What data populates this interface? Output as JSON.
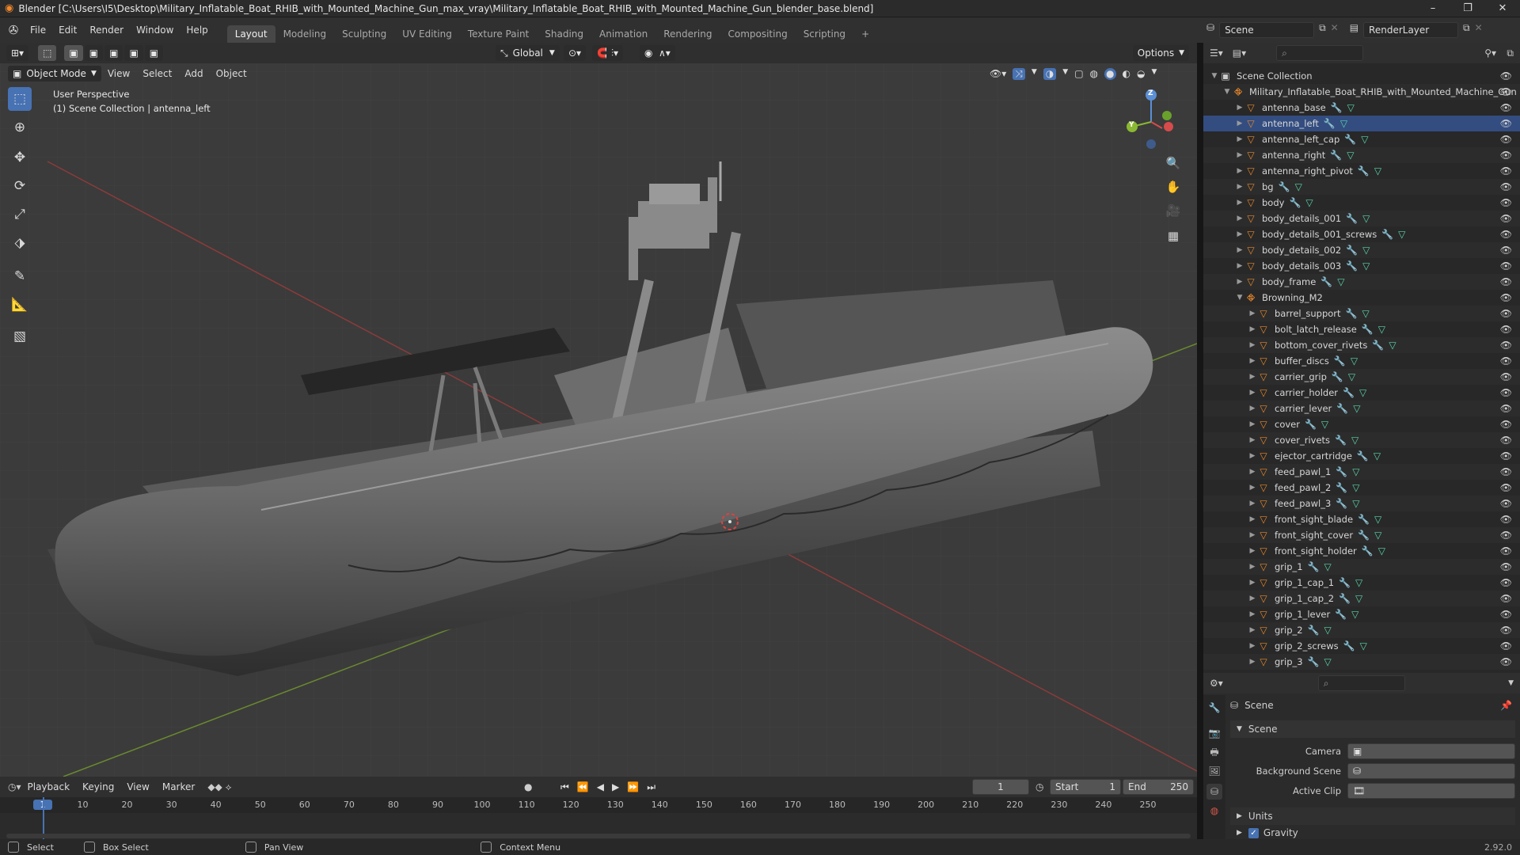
{
  "window": {
    "title": "Blender [C:\\Users\\I5\\Desktop\\Military_Inflatable_Boat_RHIB_with_Mounted_Machine_Gun_max_vray\\Military_Inflatable_Boat_RHIB_with_Mounted_Machine_Gun_blender_base.blend]",
    "controls": [
      "–",
      "❐",
      "✕"
    ]
  },
  "menubar": {
    "menus": [
      "File",
      "Edit",
      "Render",
      "Window",
      "Help"
    ],
    "workspaces": [
      "Layout",
      "Modeling",
      "Sculpting",
      "UV Editing",
      "Texture Paint",
      "Shading",
      "Animation",
      "Rendering",
      "Compositing",
      "Scripting"
    ],
    "active_workspace": "Layout",
    "add_tab": "+",
    "scene_label": "Scene",
    "render_layer_label": "RenderLayer"
  },
  "viewport": {
    "mode": "Object Mode",
    "menus": [
      "View",
      "Select",
      "Add",
      "Object"
    ],
    "transform_orientation": "Global",
    "options_label": "Options",
    "overlay_line1": "User Perspective",
    "overlay_line2": "(1) Scene Collection | antenna_left",
    "gizmo": {
      "x": "X",
      "y": "Y",
      "z": "Z"
    },
    "tools": [
      "select-box-icon",
      "cursor-icon",
      "move-icon",
      "rotate-icon",
      "scale-icon",
      "transform-icon",
      "annotate-icon",
      "measure-icon",
      "add-cube-icon"
    ]
  },
  "outliner": {
    "scene_collection": "Scene Collection",
    "root": "Military_Inflatable_Boat_RHIB_with_Mounted_Machine_Gun",
    "items": [
      {
        "name": "antenna_base",
        "level": 1
      },
      {
        "name": "antenna_left",
        "level": 1,
        "selected": true
      },
      {
        "name": "antenna_left_cap",
        "level": 1
      },
      {
        "name": "antenna_right",
        "level": 1
      },
      {
        "name": "antenna_right_pivot",
        "level": 1
      },
      {
        "name": "bg",
        "level": 1
      },
      {
        "name": "body",
        "level": 1
      },
      {
        "name": "body_details_001",
        "level": 1
      },
      {
        "name": "body_details_001_screws",
        "level": 1
      },
      {
        "name": "body_details_002",
        "level": 1
      },
      {
        "name": "body_details_003",
        "level": 1
      },
      {
        "name": "body_frame",
        "level": 1
      },
      {
        "name": "Browning_M2",
        "level": 1,
        "expanded": true,
        "group": true
      },
      {
        "name": "barrel_support",
        "level": 2
      },
      {
        "name": "bolt_latch_release",
        "level": 2
      },
      {
        "name": "bottom_cover_rivets",
        "level": 2
      },
      {
        "name": "buffer_discs",
        "level": 2
      },
      {
        "name": "carrier_grip",
        "level": 2
      },
      {
        "name": "carrier_holder",
        "level": 2
      },
      {
        "name": "carrier_lever",
        "level": 2
      },
      {
        "name": "cover",
        "level": 2
      },
      {
        "name": "cover_rivets",
        "level": 2
      },
      {
        "name": "ejector_cartridge",
        "level": 2
      },
      {
        "name": "feed_pawl_1",
        "level": 2
      },
      {
        "name": "feed_pawl_2",
        "level": 2
      },
      {
        "name": "feed_pawl_3",
        "level": 2
      },
      {
        "name": "front_sight_blade",
        "level": 2
      },
      {
        "name": "front_sight_cover",
        "level": 2
      },
      {
        "name": "front_sight_holder",
        "level": 2
      },
      {
        "name": "grip_1",
        "level": 2
      },
      {
        "name": "grip_1_cap_1",
        "level": 2
      },
      {
        "name": "grip_1_cap_2",
        "level": 2
      },
      {
        "name": "grip_1_lever",
        "level": 2
      },
      {
        "name": "grip_2",
        "level": 2
      },
      {
        "name": "grip_2_screws",
        "level": 2
      },
      {
        "name": "grip_3",
        "level": 2
      }
    ]
  },
  "properties": {
    "context": "Scene",
    "panel": "Scene",
    "fields": [
      {
        "label": "Camera",
        "value": ""
      },
      {
        "label": "Background Scene",
        "value": ""
      },
      {
        "label": "Active Clip",
        "value": ""
      }
    ],
    "subpanels": [
      "Units",
      "Gravity"
    ],
    "version": "2.92.0"
  },
  "timeline": {
    "menus": [
      "Playback",
      "Keying",
      "View",
      "Marker"
    ],
    "current_frame": "1",
    "start_label": "Start",
    "start": "1",
    "end_label": "End",
    "end": "250",
    "ruler": [
      "1",
      "10",
      "20",
      "30",
      "40",
      "50",
      "60",
      "70",
      "80",
      "90",
      "100",
      "110",
      "120",
      "130",
      "140",
      "150",
      "160",
      "170",
      "180",
      "190",
      "200",
      "210",
      "220",
      "230",
      "240",
      "250"
    ]
  },
  "statusbar": {
    "items": [
      "Select",
      "Box Select",
      "Pan View",
      "Context Menu"
    ]
  }
}
